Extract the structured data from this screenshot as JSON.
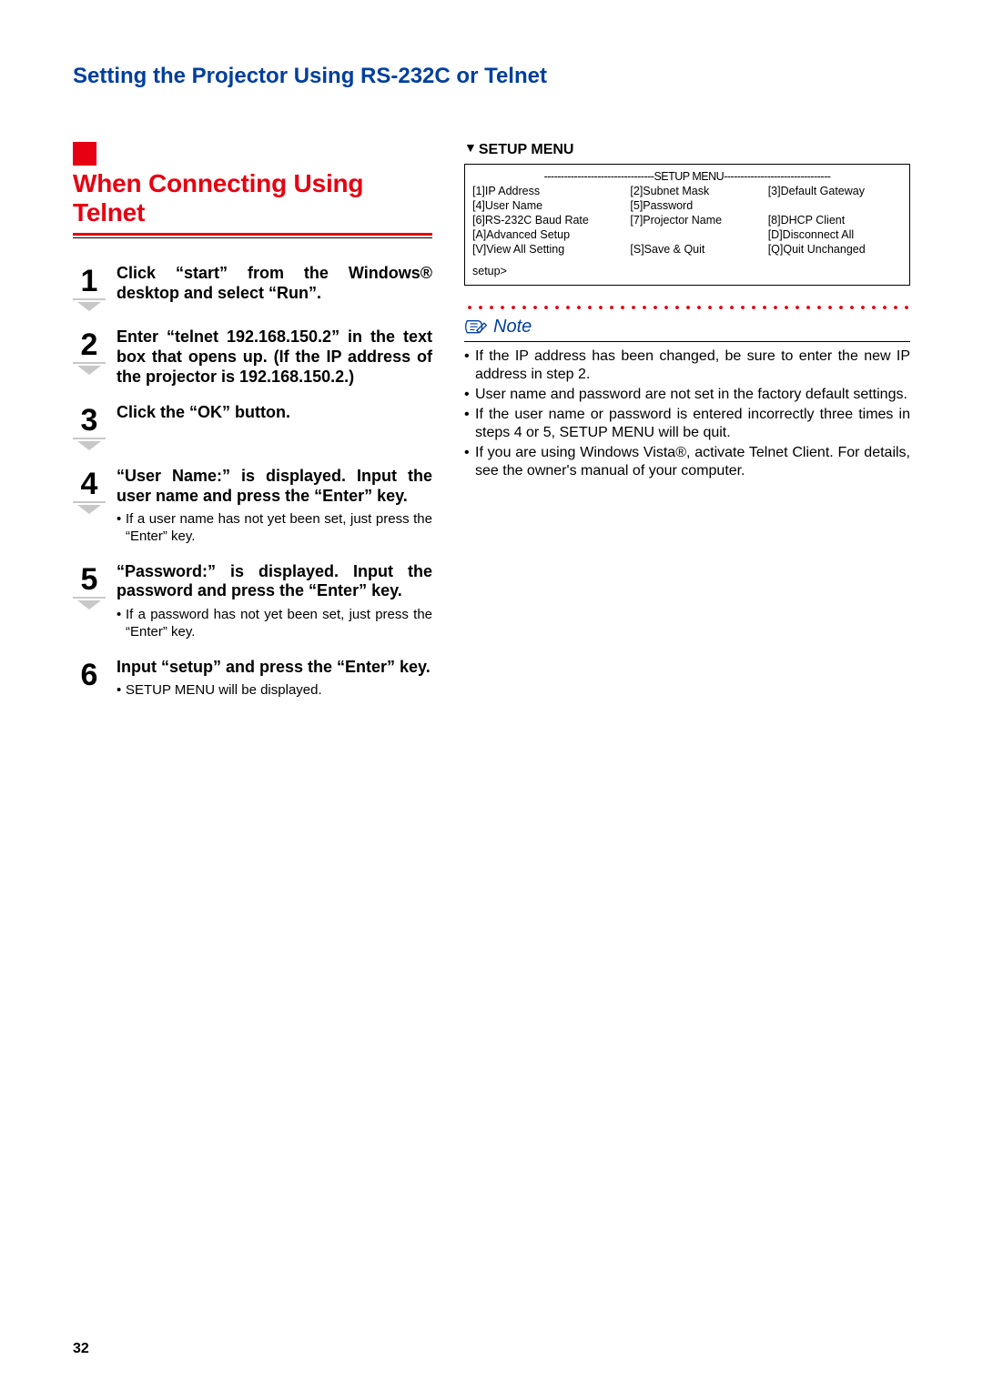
{
  "header": {
    "title": "Setting the Projector Using RS-232C or Telnet"
  },
  "section": {
    "title": "When Connecting Using Telnet"
  },
  "steps": {
    "s1": {
      "main": "Click “start” from the Windows® desktop and select “Run”."
    },
    "s2": {
      "main": "Enter “telnet 192.168.150.2” in the text box that opens up. (If the IP address of the projector is 192.168.150.2.)"
    },
    "s3": {
      "main": "Click the “OK” button."
    },
    "s4": {
      "main": "“User Name:” is displayed. Input the user name and press the “Enter” key.",
      "sub": "If a user name has not yet been set, just press the “Enter” key."
    },
    "s5": {
      "main": "“Password:” is displayed. Input the password and press the “Enter” key.",
      "sub": "If a password has not yet been set, just press the “Enter” key."
    },
    "s6": {
      "main": "Input “setup” and press the “Enter” key.",
      "sub": "SETUP MENU will be displayed."
    }
  },
  "right": {
    "setup_label": "SETUP MENU",
    "menu_dash_title": "SETUP MENU",
    "menu": {
      "r0c0": "[1]IP Address",
      "r0c1": "[2]Subnet Mask",
      "r0c2": "[3]Default Gateway",
      "r1c0": "[4]User Name",
      "r1c1": "[5]Password",
      "r1c2": "",
      "r2c0": "[6]RS-232C Baud Rate",
      "r2c1": "[7]Projector Name",
      "r2c2": "[8]DHCP Client",
      "r3c0": "[A]Advanced Setup",
      "r3c1": "",
      "r3c2": "[D]Disconnect All",
      "r4c0": "[V]View All Setting",
      "r4c1": "[S]Save & Quit",
      "r4c2": "[Q]Quit Unchanged"
    },
    "menu_prompt": "setup>",
    "note_label": "Note",
    "notes": {
      "n1": "If the IP address has been changed, be sure to enter the new IP address in step 2.",
      "n2": "User name and password are not set in the factory default settings.",
      "n3": "If the user name or password is entered incorrectly three times in steps 4 or 5, SETUP MENU will be quit.",
      "n4": "If you are using Windows Vista®, activate Telnet Client. For details, see the owner's manual of your computer."
    }
  },
  "page_number": "32"
}
